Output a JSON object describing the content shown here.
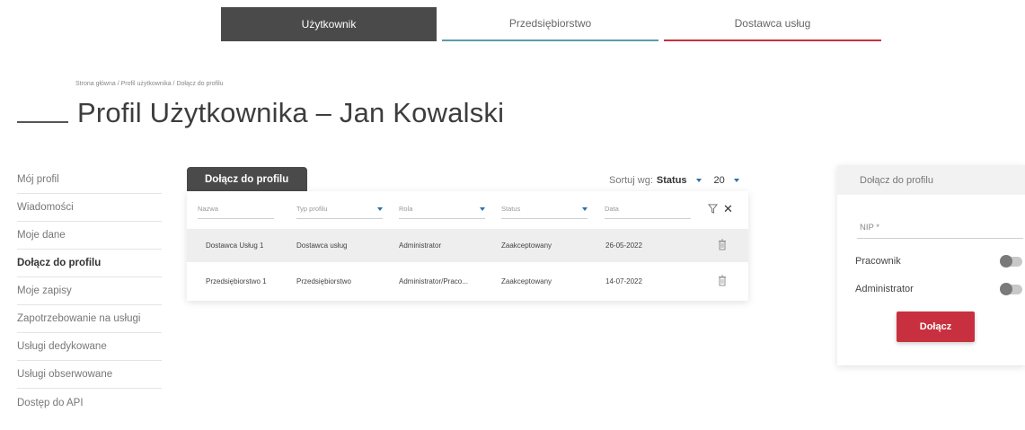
{
  "role_tabs": [
    "Użytkownik",
    "Przedsiębiorstwo",
    "Dostawca usług"
  ],
  "breadcrumb": "Strona główna / Profil użytkownika / Dołącz do profilu",
  "page_title": "Profil Użytkownika – Jan Kowalski",
  "sidebar": {
    "items": [
      {
        "label": "Mój profil"
      },
      {
        "label": "Wiadomości"
      },
      {
        "label": "Moje dane"
      },
      {
        "label": "Dołącz do profilu"
      },
      {
        "label": "Moje zapisy"
      },
      {
        "label": "Zapotrzebowanie na usługi"
      },
      {
        "label": "Usługi dedykowane"
      },
      {
        "label": "Usługi obserwowane"
      },
      {
        "label": "Dostęp do API"
      }
    ]
  },
  "main": {
    "tab_label": "Dołącz do profilu",
    "sort_label": "Sortuj wg:",
    "sort_value": "Status",
    "page_size": "20",
    "filters": {
      "name": "Nazwa",
      "type": "Typ profilu",
      "role": "Rola",
      "status": "Status",
      "date": "Data"
    },
    "rows": [
      {
        "name": "Dostawca Usług 1",
        "type": "Dostawca usług",
        "role": "Administrator",
        "status": "Zaakceptowany",
        "date": "26-05-2022"
      },
      {
        "name": "Przedsiębiorstwo 1",
        "type": "Przedsiębiorstwo",
        "role": "Administrator/Praco...",
        "status": "Zaakceptowany",
        "date": "14-07-2022"
      }
    ]
  },
  "panel": {
    "title": "Dołącz do profilu",
    "nip_placeholder": "NIP *",
    "toggle_worker": "Pracownik",
    "toggle_admin": "Administrator",
    "join_button": "Dołącz"
  },
  "colors": {
    "dark": "#4a4a4a",
    "teal": "#5d9aab",
    "red": "#c8303f",
    "blue_caret": "#2f6fa8"
  }
}
